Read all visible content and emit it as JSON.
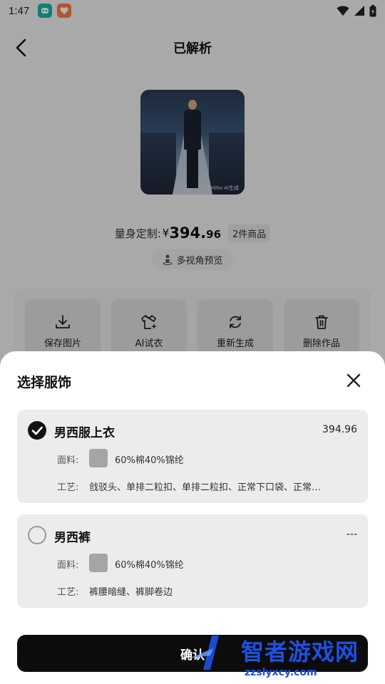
{
  "status_bar": {
    "time": "1:47"
  },
  "nav": {
    "title": "已解析"
  },
  "preview": {
    "caption": "由Hiho AI生成"
  },
  "price": {
    "label": "量身定制:",
    "currency": "¥",
    "integer": "394.",
    "decimal": "96",
    "items_badge": "2件商品"
  },
  "multi_view": {
    "label": "多视角预览"
  },
  "actions": [
    {
      "label": "保存图片",
      "icon": "download-icon"
    },
    {
      "label": "AI试衣",
      "icon": "tshirt-sparkle-icon"
    },
    {
      "label": "重新生成",
      "icon": "refresh-icon"
    },
    {
      "label": "删除作品",
      "icon": "trash-icon"
    }
  ],
  "sheet": {
    "title": "选择服饰",
    "confirm_label": "确认",
    "garments": [
      {
        "name": "男西服上衣",
        "price": "394.96",
        "selected": true,
        "fabric_label": "面料:",
        "fabric_value": "60%棉40%锦纶",
        "craft_label": "工艺:",
        "craft_value": "戗驳头、单排二粒扣、单排二粒扣、正常下口袋、正常…"
      },
      {
        "name": "男西裤",
        "price": "---",
        "selected": false,
        "fabric_label": "面料:",
        "fabric_value": "60%棉40%锦纶",
        "craft_label": "工艺:",
        "craft_value": "裤腰暗缝、裤脚卷边"
      }
    ]
  },
  "watermark": {
    "text": "智者游戏网",
    "url": "zzslyxcy.com"
  },
  "colors": {
    "accent": "#0c0c0c",
    "sheet_bg": "#ffffff",
    "card_bg": "#ececec",
    "watermark": "#1f50e3"
  }
}
